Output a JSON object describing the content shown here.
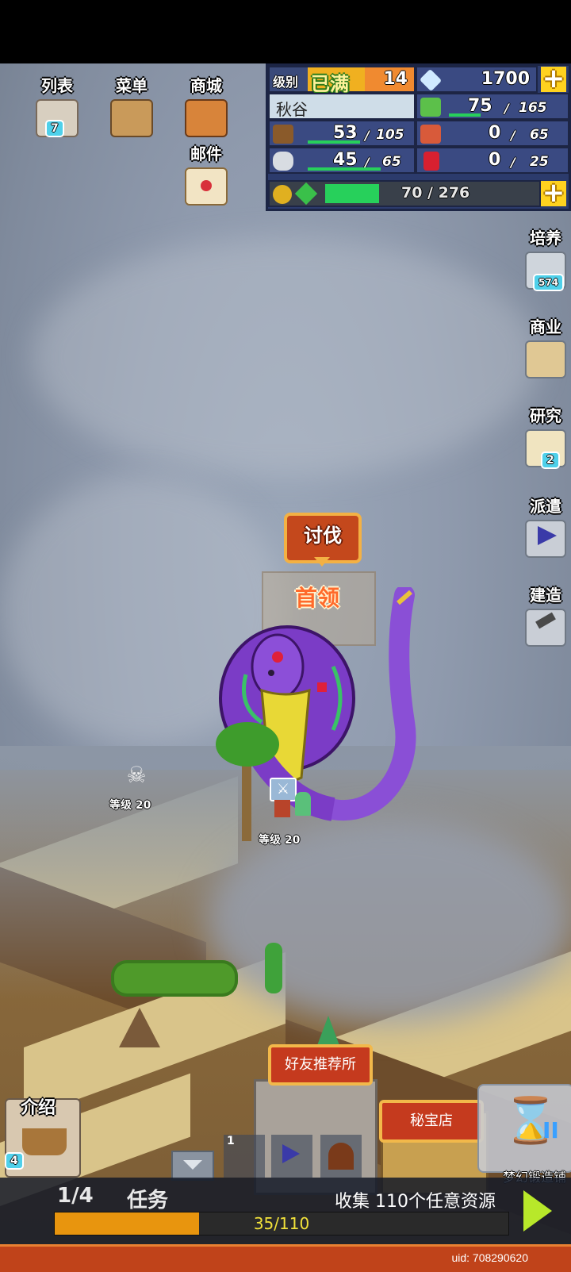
{
  "top_nav": {
    "list_label": "列表",
    "list_badge": "7",
    "menu_label": "菜单",
    "shop_label": "商城",
    "mail_label": "邮件"
  },
  "resources": {
    "level_label": "级别",
    "level_status": "已满",
    "level_value": "14",
    "gems": "1700",
    "town_name": "秋谷",
    "grass": {
      "current": "75",
      "max": "165",
      "ratio": 0.45
    },
    "wood": {
      "current": "53",
      "max": "105",
      "ratio": 0.5
    },
    "food": {
      "current": "0",
      "max": "65",
      "ratio": 0
    },
    "stone": {
      "current": "45",
      "max": "65",
      "ratio": 0.69
    },
    "ruby": {
      "current": "0",
      "max": "25",
      "ratio": 0
    },
    "exp_text": "70 / 276",
    "exp_ratio": 0.25
  },
  "side_nav": {
    "train_label": "培养",
    "train_badge": "574",
    "business_label": "商业",
    "research_label": "研究",
    "research_badge": "2",
    "dispatch_label": "派遣",
    "build_label": "建造"
  },
  "map": {
    "subjugate_label": "讨伐",
    "boss_label": "首领",
    "enemy_level": "等级 20",
    "hero_level": "等级 20",
    "friend_facility": "好友推荐所",
    "treasure_shop": "秘宝店",
    "intro_label": "介绍",
    "intro_badge": "4",
    "toolbar_badge": "1",
    "forge_label": "梦幻锻造铺"
  },
  "quest": {
    "count": "1/4",
    "label": "任务",
    "description": "收集 110个任意资源",
    "progress_text": "35/110",
    "progress_ratio": 0.318
  },
  "uid": "uid: 708290620",
  "colors": {
    "accent_gold": "#ffd21f",
    "quest_bar": "#e8950e",
    "resource_bar": "#27d05b",
    "banner_red": "#c4481c",
    "boss_purple": "#7b3cc6"
  }
}
